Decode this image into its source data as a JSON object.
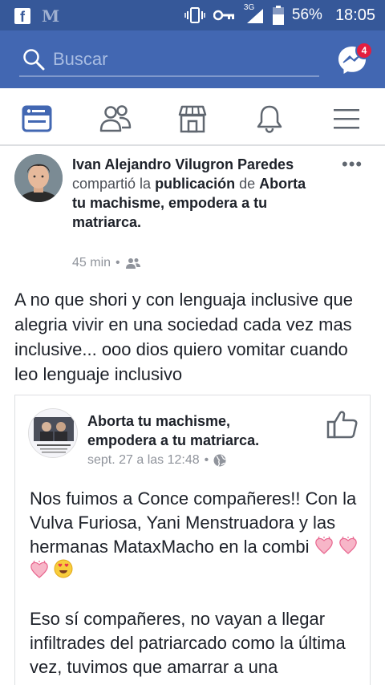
{
  "status_bar": {
    "signal_label": "3G",
    "battery": "56%",
    "time": "18:05"
  },
  "search": {
    "placeholder": "Buscar",
    "messenger_badge": "4"
  },
  "nav": {
    "items": [
      "news-feed",
      "friends",
      "marketplace",
      "notifications",
      "menu"
    ],
    "active": "news-feed"
  },
  "post": {
    "author": "Ivan Alejandro Vilugron Paredes",
    "action": "compartió la",
    "publication_word": "publicación",
    "preposition": "de",
    "page": "Aborta tu machisme, empodera a tu matriarca.",
    "time": "45 min",
    "audience_icon": "friends-icon",
    "text": "A no que shori y con lenguaja inclusive que alegria vivir en una sociedad cada vez mas inclusive... ooo dios quiero vomitar cuando leo lenguaje inclusivo"
  },
  "shared_post": {
    "page_name": "Aborta tu machisme, empodera a tu matriarca.",
    "time": "sept. 27 a las 12:48",
    "audience_icon": "globe-icon",
    "paragraph1": "Nos fuimos a Conce compañeres!! Con la Vulva Furiosa, Yani Menstruadora y las hermanas MataxMacho en la combi",
    "emojis": [
      "sparkling-heart",
      "sparkling-heart",
      "sparkling-heart",
      "heart-eyes"
    ],
    "paragraph2": "Eso sí compañeres, no vayan a llegar infiltrades del patriarcado como la última vez, tuvimos que amarrar a una"
  },
  "colors": {
    "status_bar": "#365899",
    "header": "#4267b2",
    "active_nav": "#4267b2",
    "badge": "#e41e3f"
  }
}
